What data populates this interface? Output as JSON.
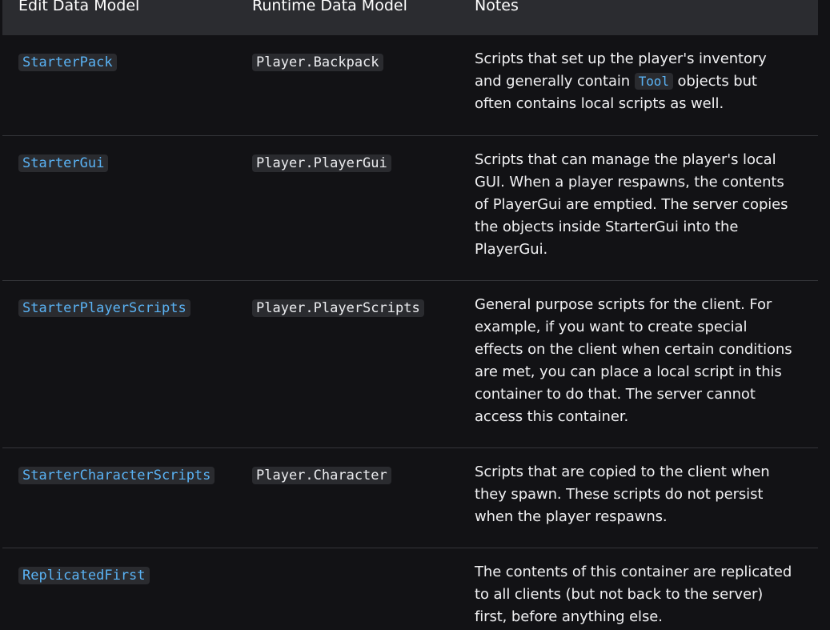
{
  "header": {
    "col1": "Edit Data Model",
    "col2": "Runtime Data Model",
    "col3": "Notes"
  },
  "rows": [
    {
      "edit": "StarterPack",
      "runtime": "Player.Backpack",
      "notes_before": "Scripts that set up the player's inventory and generally contain ",
      "notes_code": "Tool",
      "notes_after": " objects but often contains local scripts as well."
    },
    {
      "edit": "StarterGui",
      "runtime": "Player.PlayerGui",
      "notes": "Scripts that can manage the player's local GUI. When a player respawns, the contents of PlayerGui are emptied. The server copies the objects inside StarterGui into the PlayerGui."
    },
    {
      "edit": "StarterPlayerScripts",
      "runtime": "Player.PlayerScripts",
      "notes": "General purpose scripts for the client. For example, if you want to create special effects on the client when certain conditions are met, you can place a local script in this container to do that. The server cannot access this container."
    },
    {
      "edit": "StarterCharacterScripts",
      "runtime": "Player.Character",
      "notes": "Scripts that are copied to the client when they spawn. These scripts do not persist when the player respawns."
    },
    {
      "edit": "ReplicatedFirst",
      "runtime": "",
      "notes": "The contents of this container are replicated to all clients (but not back to the server) first, before anything else."
    }
  ]
}
